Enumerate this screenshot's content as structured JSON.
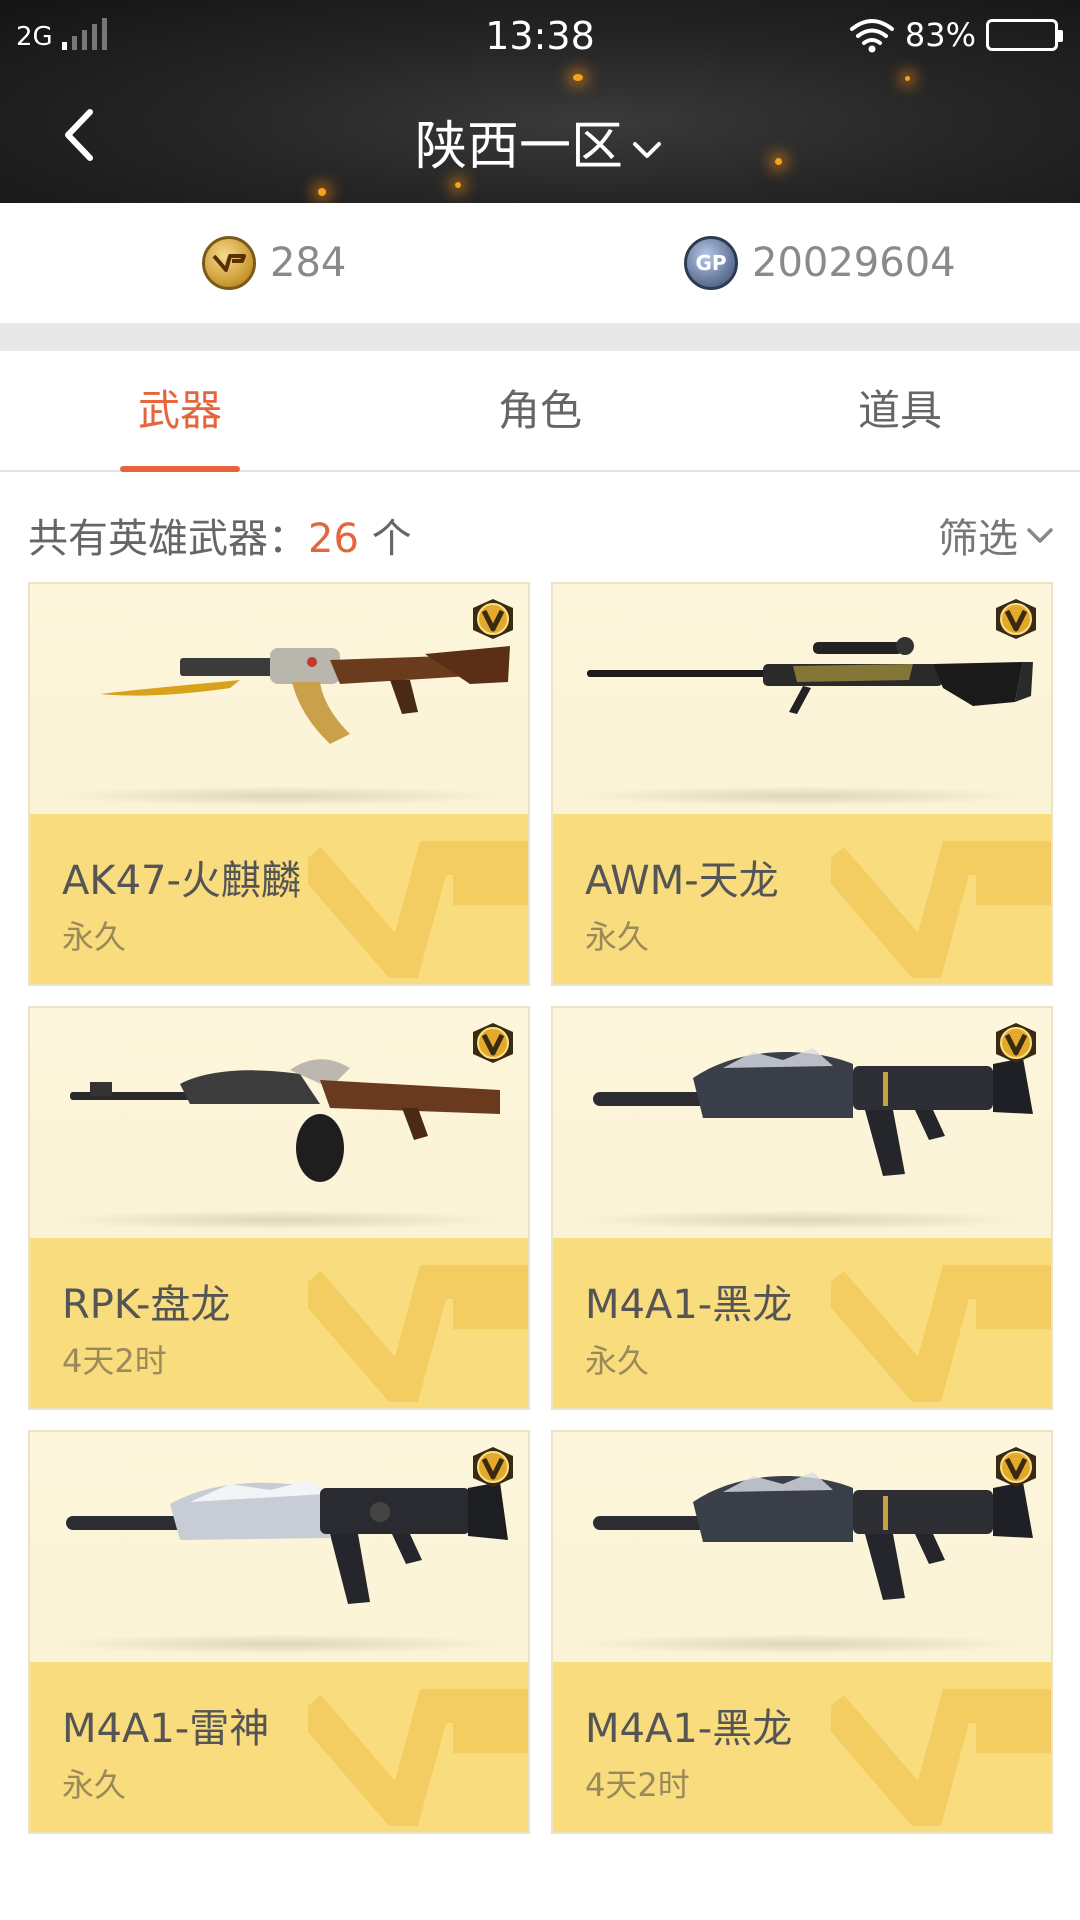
{
  "status_bar": {
    "network": "2G",
    "time": "13:38",
    "battery": "83%",
    "battery_level": 0.83
  },
  "header": {
    "region": "陕西一区"
  },
  "currency": {
    "cf_points": "284",
    "gp": "20029604"
  },
  "tabs": [
    {
      "label": "武器",
      "active": true
    },
    {
      "label": "角色",
      "active": false
    },
    {
      "label": "道具",
      "active": false
    }
  ],
  "summary": {
    "label": "共有英雄武器：",
    "count": "26",
    "unit": " 个",
    "filter_label": "筛选"
  },
  "weapons": [
    {
      "name": "AK47-火麒麟",
      "duration": "永久",
      "gun": "ak-gold"
    },
    {
      "name": "AWM-天龙",
      "duration": "永久",
      "gun": "sniper"
    },
    {
      "name": "RPK-盘龙",
      "duration": "4天2时",
      "gun": "ak-drum"
    },
    {
      "name": "M4A1-黑龙",
      "duration": "永久",
      "gun": "m4-dark"
    },
    {
      "name": "M4A1-雷神",
      "duration": "永久",
      "gun": "m4-silver"
    },
    {
      "name": "M4A1-黑龙",
      "duration": "4天2时",
      "gun": "m4-dark"
    }
  ],
  "colors": {
    "accent": "#e5663a",
    "card_info_bg": "#f8dc7e",
    "card_image_bg": "#fdf6de"
  }
}
